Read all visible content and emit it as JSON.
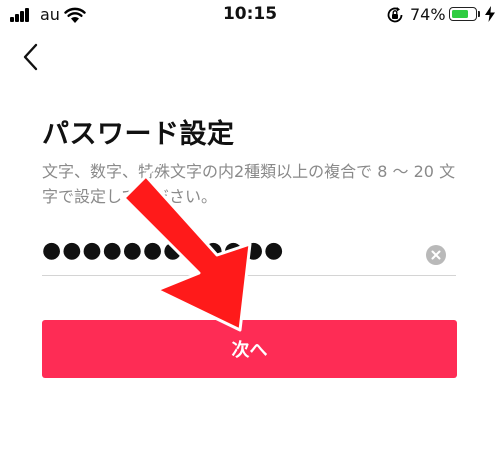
{
  "status_bar": {
    "carrier": "au",
    "time": "10:15",
    "battery_percent": "74%",
    "battery_level": 0.74,
    "icons": [
      "signal-icon",
      "wifi-icon",
      "rotation-lock-icon",
      "battery-icon",
      "charging-icon"
    ],
    "battery_color": "#2ecc40"
  },
  "nav": {
    "back_icon": "chevron-left-icon"
  },
  "page": {
    "title": "パスワード設定",
    "description": "文字、数字、特殊文字の内2種類以上の複合で 8 〜 20 文字で設定してください。"
  },
  "password_field": {
    "value": "●●●●●●●●●●●●",
    "clear_icon": "clear-icon"
  },
  "next_button": {
    "label": "次へ",
    "color": "#fe2c55"
  },
  "annotation": {
    "icon": "red-arrow-icon",
    "color": "#ff0000"
  }
}
